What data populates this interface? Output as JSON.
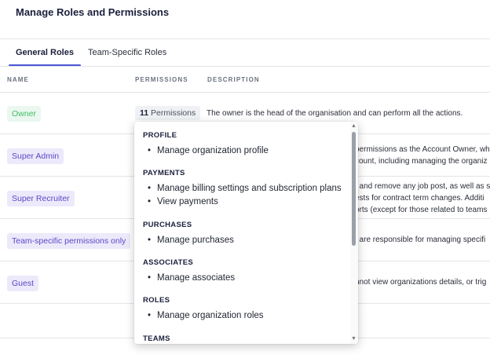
{
  "header": {
    "title": "Manage Roles and Permissions"
  },
  "tabs": [
    {
      "label": "General Roles",
      "active": true
    },
    {
      "label": "Team-Specific Roles",
      "active": false
    }
  ],
  "table": {
    "columns": {
      "name": "NAME",
      "permissions": "PERMISSIONS",
      "description": "DESCRIPTION"
    },
    "rows": [
      {
        "name": "Owner",
        "permissions_count": "11",
        "permissions_word": "Permissions",
        "description": "The owner is the head of the organisation and can perform all the actions."
      },
      {
        "name": "Super Admin",
        "description_lines": [
          "permissions as the Account Owner, wh",
          "count, including managing the organiz"
        ]
      },
      {
        "name": "Super Recruiter",
        "description_lines": [
          ", and remove any job post, as well as s",
          "ests for contract term changes. Additi",
          "orts (except for those related to teams"
        ]
      },
      {
        "name": "Team-specific permissions only",
        "description_lines": [
          "t are responsible for managing specifi"
        ]
      },
      {
        "name": "Guest",
        "description_lines": [
          "nnot view organizations details, or trig"
        ]
      }
    ]
  },
  "permissions_popover": {
    "sections": [
      {
        "title": "PROFILE",
        "items": [
          "Manage organization profile"
        ]
      },
      {
        "title": "PAYMENTS",
        "items": [
          "Manage billing settings and subscription plans",
          "View payments"
        ]
      },
      {
        "title": "PURCHASES",
        "items": [
          "Manage purchases"
        ]
      },
      {
        "title": "ASSOCIATES",
        "items": [
          "Manage associates"
        ]
      },
      {
        "title": "ROLES",
        "items": [
          "Manage organization roles"
        ]
      },
      {
        "title": "TEAMS",
        "items": []
      }
    ],
    "scroll_up_icon": "triangle-up",
    "scroll_down_icon": "triangle-down"
  },
  "colors": {
    "accent": "#4b56d2",
    "owner_badge_bg": "#eaf8ef",
    "owner_badge_text": "#3fbf63",
    "role_badge_bg": "#ece9fb",
    "role_badge_text": "#5b49c7"
  }
}
